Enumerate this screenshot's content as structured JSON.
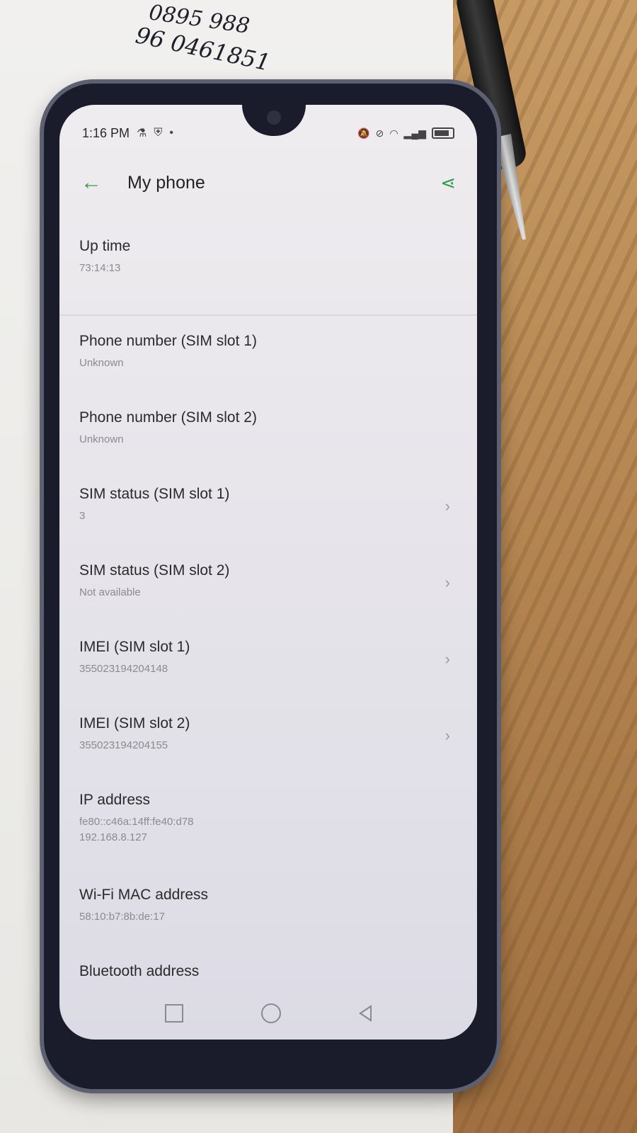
{
  "handwriting": {
    "line1": "0895 988",
    "line2": "96 0461851"
  },
  "status_bar": {
    "time": "1:16 PM"
  },
  "app_bar": {
    "title": "My phone"
  },
  "items": [
    {
      "label": "Up time",
      "value": "73:14:13",
      "chevron": false
    },
    {
      "label": "Phone number (SIM slot 1)",
      "value": "Unknown",
      "chevron": false
    },
    {
      "label": "Phone number (SIM slot 2)",
      "value": "Unknown",
      "chevron": false
    },
    {
      "label": "SIM status (SIM slot 1)",
      "value": "3",
      "chevron": true
    },
    {
      "label": "SIM status (SIM slot 2)",
      "value": "Not available",
      "chevron": true
    },
    {
      "label": "IMEI (SIM slot 1)",
      "value": "355023194204148",
      "chevron": true
    },
    {
      "label": "IMEI (SIM slot 2)",
      "value": "355023194204155",
      "chevron": true
    },
    {
      "label": "IP address",
      "value": "fe80::c46a:14ff:fe40:d78",
      "value2": "192.168.8.127",
      "chevron": false
    },
    {
      "label": "Wi-Fi MAC address",
      "value": "58:10:b7:8b:de:17",
      "chevron": false
    },
    {
      "label": "Bluetooth address",
      "value": "",
      "chevron": false
    }
  ],
  "colors": {
    "accent": "#2e9e4d"
  },
  "icons": {
    "back": "arrow-left-icon",
    "share": "share-icon"
  }
}
